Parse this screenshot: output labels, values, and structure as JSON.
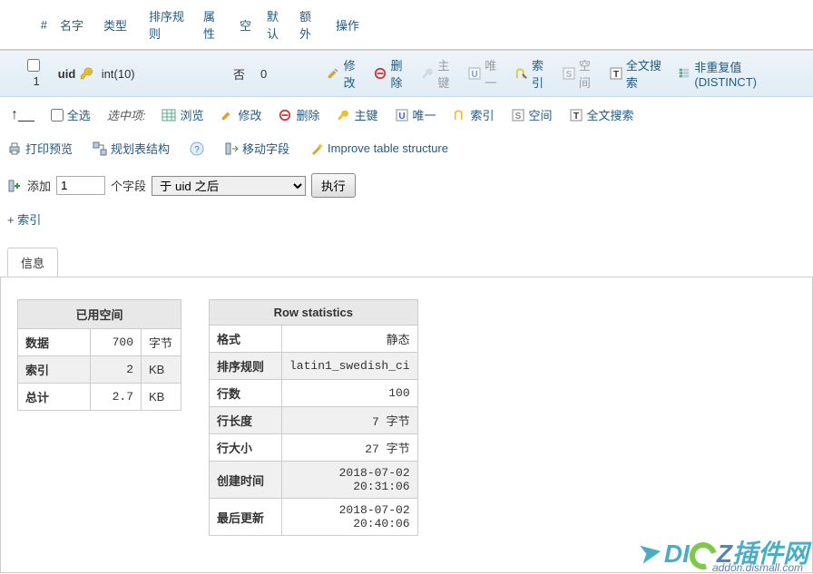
{
  "columns_header": {
    "num": "#",
    "name": "名字",
    "type": "类型",
    "collation": "排序规则",
    "attr": "属性",
    "null": "空",
    "default": "默认",
    "extra": "额外",
    "ops": "操作"
  },
  "row": {
    "num": "1",
    "name": "uid",
    "type": "int(10)",
    "null": "否",
    "default": "0",
    "actions": {
      "edit": "修改",
      "drop": "删除",
      "primary": "主键",
      "unique": "唯一",
      "index": "索引",
      "spatial": "空间",
      "fulltext": "全文搜索",
      "distinct": "非重复值 (DISTINCT)"
    }
  },
  "footer": {
    "check_all": "全选",
    "with_selected": "选中项:",
    "browse": "浏览",
    "edit": "修改",
    "drop": "删除",
    "primary": "主键",
    "unique": "唯一",
    "index": "索引",
    "spatial": "空间",
    "fulltext": "全文搜索"
  },
  "toolbar2": {
    "print": "打印预览",
    "propose": "规划表结构",
    "move": "移动字段",
    "improve": "Improve table structure"
  },
  "addfields": {
    "prefix": "添加",
    "count": "1",
    "mid": "个字段",
    "position": "于 uid 之后",
    "go": "执行"
  },
  "plus_index": "+ 索引",
  "tab_info": "信息",
  "space": {
    "title": "已用空间",
    "rows": [
      {
        "label": "数据",
        "value": "700",
        "unit": "字节"
      },
      {
        "label": "索引",
        "value": "2",
        "unit": "KB"
      },
      {
        "label": "总计",
        "value": "2.7",
        "unit": "KB"
      }
    ]
  },
  "stats": {
    "title": "Row statistics",
    "rows": [
      {
        "label": "格式",
        "value": "静态"
      },
      {
        "label": "排序规则",
        "value": "latin1_swedish_ci"
      },
      {
        "label": "行数",
        "value": "100"
      },
      {
        "label": "行长度",
        "value": "7 字节"
      },
      {
        "label": "行大小",
        "value": "27 字节"
      },
      {
        "label": "创建时间",
        "value": "2018-07-02 20:31:06"
      },
      {
        "label": "最后更新",
        "value": "2018-07-02 20:40:06"
      }
    ]
  },
  "watermark": {
    "text1": "DI",
    "text2": "Z",
    "text3": "插件网",
    "sub": "addon.dismall.com"
  }
}
